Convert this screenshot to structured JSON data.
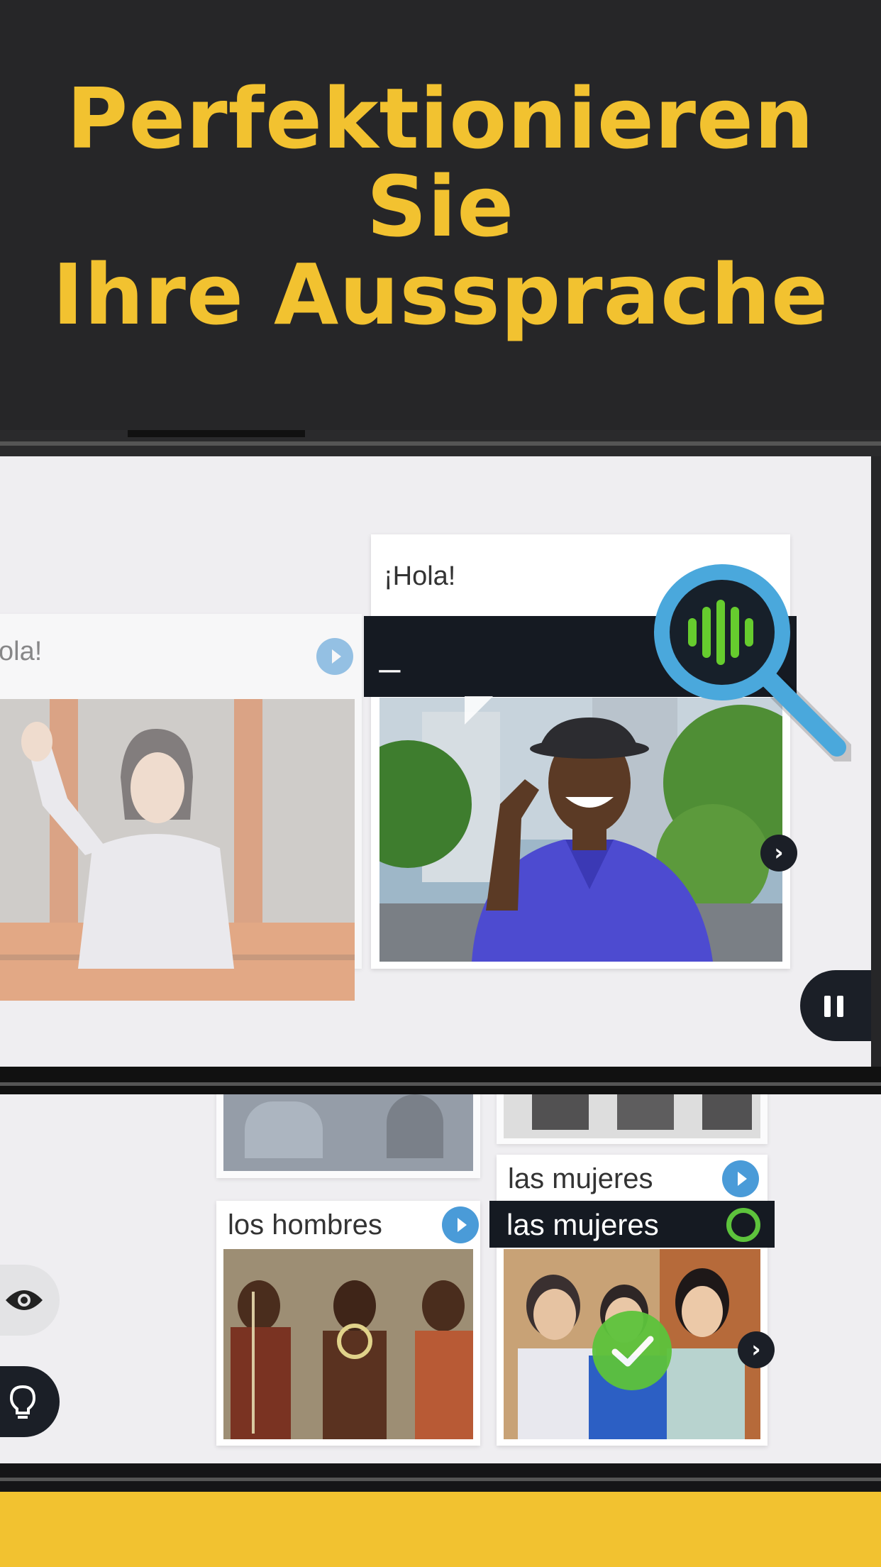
{
  "headline": {
    "line1": "Perfektionieren Sie",
    "line2": "Ihre Aussprache"
  },
  "lesson_top": {
    "left_card_title": "ola!",
    "main_card_title": "¡Hola!",
    "answer_text": "_"
  },
  "lesson_bottom": {
    "card_left_title": "los hombres",
    "card_right_title": "las mujeres",
    "card_right_answer": "las mujeres"
  },
  "icons": {
    "play": "play-icon",
    "next": "chevron-right-icon",
    "pause": "pause-icon",
    "eye": "eye-icon",
    "hint": "lightbulb-icon",
    "magnifier": "magnifier-voice-icon",
    "check": "check-icon"
  },
  "colors": {
    "headline": "#F2C230",
    "background": "#262628",
    "accent_blue": "#4A9BD8",
    "success_green": "#5DC33C",
    "footer": "#F2C230"
  }
}
